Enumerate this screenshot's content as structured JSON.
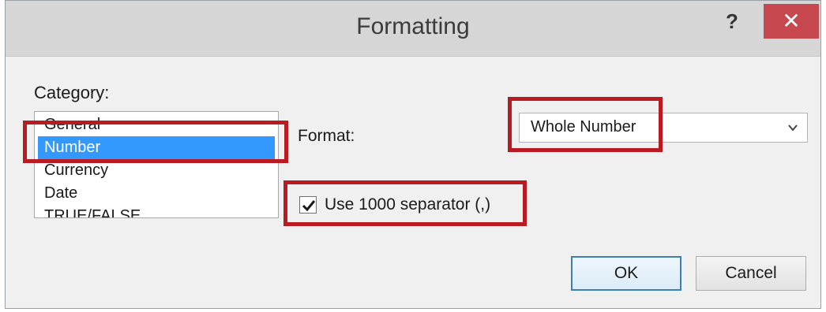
{
  "window": {
    "title": "Formatting",
    "help_label": "?",
    "close_label": "✕"
  },
  "category": {
    "label": "Category:",
    "items": [
      "General",
      "Number",
      "Currency",
      "Date",
      "TRUE/FALSE"
    ],
    "selected": "Number"
  },
  "format": {
    "label": "Format:",
    "value": "Whole Number"
  },
  "separator": {
    "label": "Use 1000 separator (,)",
    "checked": true
  },
  "buttons": {
    "ok_label": "OK",
    "cancel_label": "Cancel"
  },
  "colors": {
    "selection": "#3399ff",
    "highlight": "#b81c22",
    "close_button": "#c7484f"
  },
  "icons": {
    "dropdown": "chevron-down-icon",
    "checkbox": "checkmark-icon"
  }
}
